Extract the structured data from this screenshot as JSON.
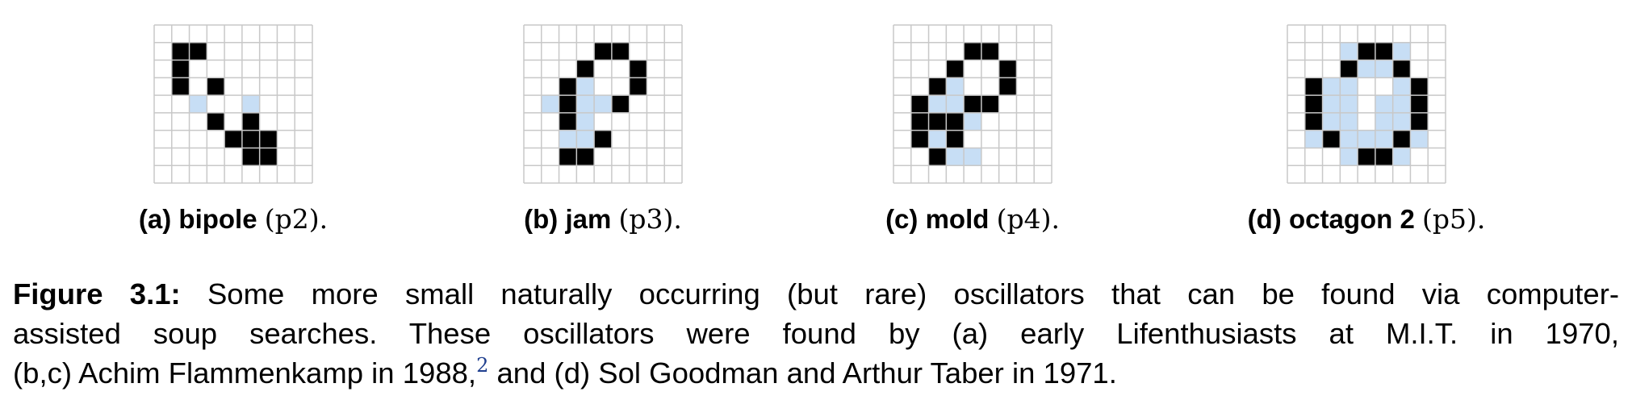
{
  "colors": {
    "alive": "#000000",
    "ghost": "#c7def5",
    "grid_line": "#c8c8c8",
    "background": "#ffffff",
    "footnote_link": "#1f3f8f"
  },
  "panels": [
    {
      "id": "a",
      "label_tag": "(a)",
      "name": "bipole",
      "period": "(p2).",
      "rows": 7,
      "cols": 7,
      "alive": [
        [
          1,
          1
        ],
        [
          1,
          2
        ],
        [
          2,
          1
        ],
        [
          3,
          1
        ],
        [
          3,
          3
        ],
        [
          5,
          3
        ],
        [
          6,
          4
        ],
        [
          5,
          5
        ],
        [
          6,
          5
        ],
        [
          6,
          6
        ],
        [
          7,
          5
        ],
        [
          7,
          6
        ]
      ],
      "ghost": [
        [
          4,
          2
        ],
        [
          4,
          5
        ]
      ]
    },
    {
      "id": "b",
      "label_tag": "(b)",
      "name": "jam",
      "period": "(p3).",
      "rows": 7,
      "cols": 7,
      "alive": [
        [
          1,
          4
        ],
        [
          1,
          5
        ],
        [
          2,
          3
        ],
        [
          2,
          6
        ],
        [
          3,
          2
        ],
        [
          3,
          6
        ],
        [
          4,
          2
        ],
        [
          4,
          5
        ],
        [
          5,
          2
        ],
        [
          6,
          4
        ],
        [
          7,
          2
        ],
        [
          7,
          3
        ]
      ],
      "ghost": [
        [
          3,
          3
        ],
        [
          4,
          3
        ],
        [
          4,
          4
        ],
        [
          4,
          1
        ],
        [
          5,
          3
        ],
        [
          6,
          2
        ],
        [
          6,
          3
        ]
      ],
      "note": "alive/ghost given as [row, col] in cell units"
    },
    {
      "id": "c",
      "label_tag": "(c)",
      "name": "mold",
      "period": "(p4).",
      "rows": 7,
      "cols": 7,
      "alive": [
        [
          1,
          4
        ],
        [
          1,
          5
        ],
        [
          2,
          3
        ],
        [
          2,
          6
        ],
        [
          3,
          2
        ],
        [
          3,
          6
        ],
        [
          4,
          1
        ],
        [
          4,
          4
        ],
        [
          4,
          5
        ],
        [
          5,
          1
        ],
        [
          5,
          2
        ],
        [
          5,
          3
        ],
        [
          6,
          1
        ],
        [
          6,
          3
        ],
        [
          7,
          2
        ]
      ],
      "ghost": [
        [
          3,
          3
        ],
        [
          4,
          2
        ],
        [
          4,
          3
        ],
        [
          5,
          4
        ],
        [
          6,
          2
        ],
        [
          7,
          3
        ],
        [
          7,
          4
        ]
      ]
    },
    {
      "id": "d",
      "label_tag": "(d)",
      "name": "octagon 2",
      "period": "(p5).",
      "rows": 7,
      "cols": 7,
      "alive": [
        [
          1,
          4
        ],
        [
          1,
          5
        ],
        [
          2,
          3
        ],
        [
          2,
          6
        ],
        [
          3,
          1
        ],
        [
          3,
          7
        ],
        [
          4,
          1
        ],
        [
          4,
          7
        ],
        [
          5,
          1
        ],
        [
          5,
          7
        ],
        [
          6,
          2
        ],
        [
          6,
          6
        ],
        [
          7,
          4
        ],
        [
          7,
          5
        ]
      ],
      "ghost": [
        [
          1,
          3
        ],
        [
          1,
          6
        ],
        [
          2,
          4
        ],
        [
          2,
          5
        ],
        [
          3,
          2
        ],
        [
          3,
          3
        ],
        [
          3,
          6
        ],
        [
          4,
          2
        ],
        [
          4,
          3
        ],
        [
          4,
          5
        ],
        [
          4,
          6
        ],
        [
          5,
          2
        ],
        [
          5,
          3
        ],
        [
          5,
          5
        ],
        [
          5,
          6
        ],
        [
          6,
          1
        ],
        [
          6,
          3
        ],
        [
          6,
          4
        ],
        [
          6,
          5
        ],
        [
          6,
          7
        ],
        [
          7,
          3
        ],
        [
          7,
          6
        ]
      ]
    }
  ],
  "caption": {
    "label": "Figure 3.1:",
    "line1": " Some more small naturally occurring (but rare) oscillators that can be found via computer-",
    "line2": "assisted soup searches.  These oscillators were found by (a) early Lifenthusiasts at M.I.T. in 1970,",
    "line3a": "(b,c) Achim Flammenkamp in 1988,",
    "footnote": "2",
    "line3b": " and (d) Sol Goodman and Arthur Taber in 1971."
  }
}
